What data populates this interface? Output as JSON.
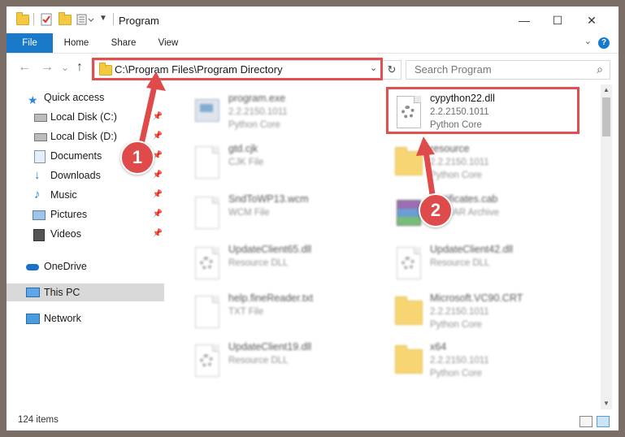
{
  "window": {
    "title": "Program",
    "controls": {
      "minimize": "—",
      "maximize": "☐",
      "close": "✕"
    }
  },
  "ribbon": {
    "tabs": [
      {
        "label": "File"
      },
      {
        "label": "Home"
      },
      {
        "label": "Share"
      },
      {
        "label": "View"
      }
    ],
    "help": "?"
  },
  "nav": {
    "back": "←",
    "forward": "→",
    "recent": "⌄",
    "up": "↑",
    "address": "C:\\Program Files\\Program Directory",
    "search_placeholder": "Search Program"
  },
  "sidebar": {
    "items": [
      {
        "label": "Quick access",
        "icon": "star-icon",
        "pinned": false
      },
      {
        "label": "Local Disk (C:)",
        "icon": "drive-icon",
        "pinned": true
      },
      {
        "label": "Local Disk (D:)",
        "icon": "drive-icon",
        "pinned": true
      },
      {
        "label": "Documents",
        "icon": "documents-icon",
        "pinned": true
      },
      {
        "label": "Downloads",
        "icon": "download-icon",
        "pinned": true
      },
      {
        "label": "Music",
        "icon": "music-icon",
        "pinned": true
      },
      {
        "label": "Pictures",
        "icon": "pictures-icon",
        "pinned": true
      },
      {
        "label": "Videos",
        "icon": "videos-icon",
        "pinned": true
      },
      {
        "label": "OneDrive",
        "icon": "cloud-icon",
        "pinned": false
      },
      {
        "label": "This PC",
        "icon": "computer-icon",
        "pinned": false,
        "selected": true
      },
      {
        "label": "Network",
        "icon": "network-icon",
        "pinned": false
      }
    ]
  },
  "files": [
    {
      "name": "program.exe",
      "line2": "2.2.2150.1011",
      "line3": "Python Core",
      "icon": "exe-icon"
    },
    {
      "name": "cypython22.dll",
      "line2": "2.2.2150.1011",
      "line3": "Python Core",
      "icon": "dll-gear-icon",
      "highlighted": true
    },
    {
      "name": "gtd.cjk",
      "line2": "CJK File",
      "line3": "",
      "icon": "file-icon"
    },
    {
      "name": "resource",
      "line2": "2.2.2150.1011",
      "line3": "Python Core",
      "icon": "folder-icon"
    },
    {
      "name": "SndToWP13.wcm",
      "line2": "WCM File",
      "line3": "",
      "icon": "file-icon"
    },
    {
      "name": "certificates.cab",
      "line2": "WinRAR Archive",
      "line3": "",
      "icon": "archive-icon"
    },
    {
      "name": "UpdateClient65.dll",
      "line2": "Resource DLL",
      "line3": "",
      "icon": "dll-gear-icon"
    },
    {
      "name": "UpdateClient42.dll",
      "line2": "Resource DLL",
      "line3": "",
      "icon": "dll-gear-icon"
    },
    {
      "name": "help.fineReader.txt",
      "line2": "TXT File",
      "line3": "",
      "icon": "file-icon"
    },
    {
      "name": "Microsoft.VC90.CRT",
      "line2": "2.2.2150.1011",
      "line3": "Python Core",
      "icon": "folder-icon"
    },
    {
      "name": "UpdateClient19.dll",
      "line2": "Resource DLL",
      "line3": "",
      "icon": "dll-gear-icon"
    },
    {
      "name": "x64",
      "line2": "2.2.2150.1011",
      "line3": "Python Core",
      "icon": "folder-icon"
    }
  ],
  "status": {
    "item_count": "124 items"
  },
  "annotations": [
    {
      "number": "1",
      "color": "#df4a4a"
    },
    {
      "number": "2",
      "color": "#df4a4a"
    }
  ],
  "colors": {
    "accent": "#1979ca",
    "highlight": "#e05050",
    "folder": "#f3c843"
  }
}
